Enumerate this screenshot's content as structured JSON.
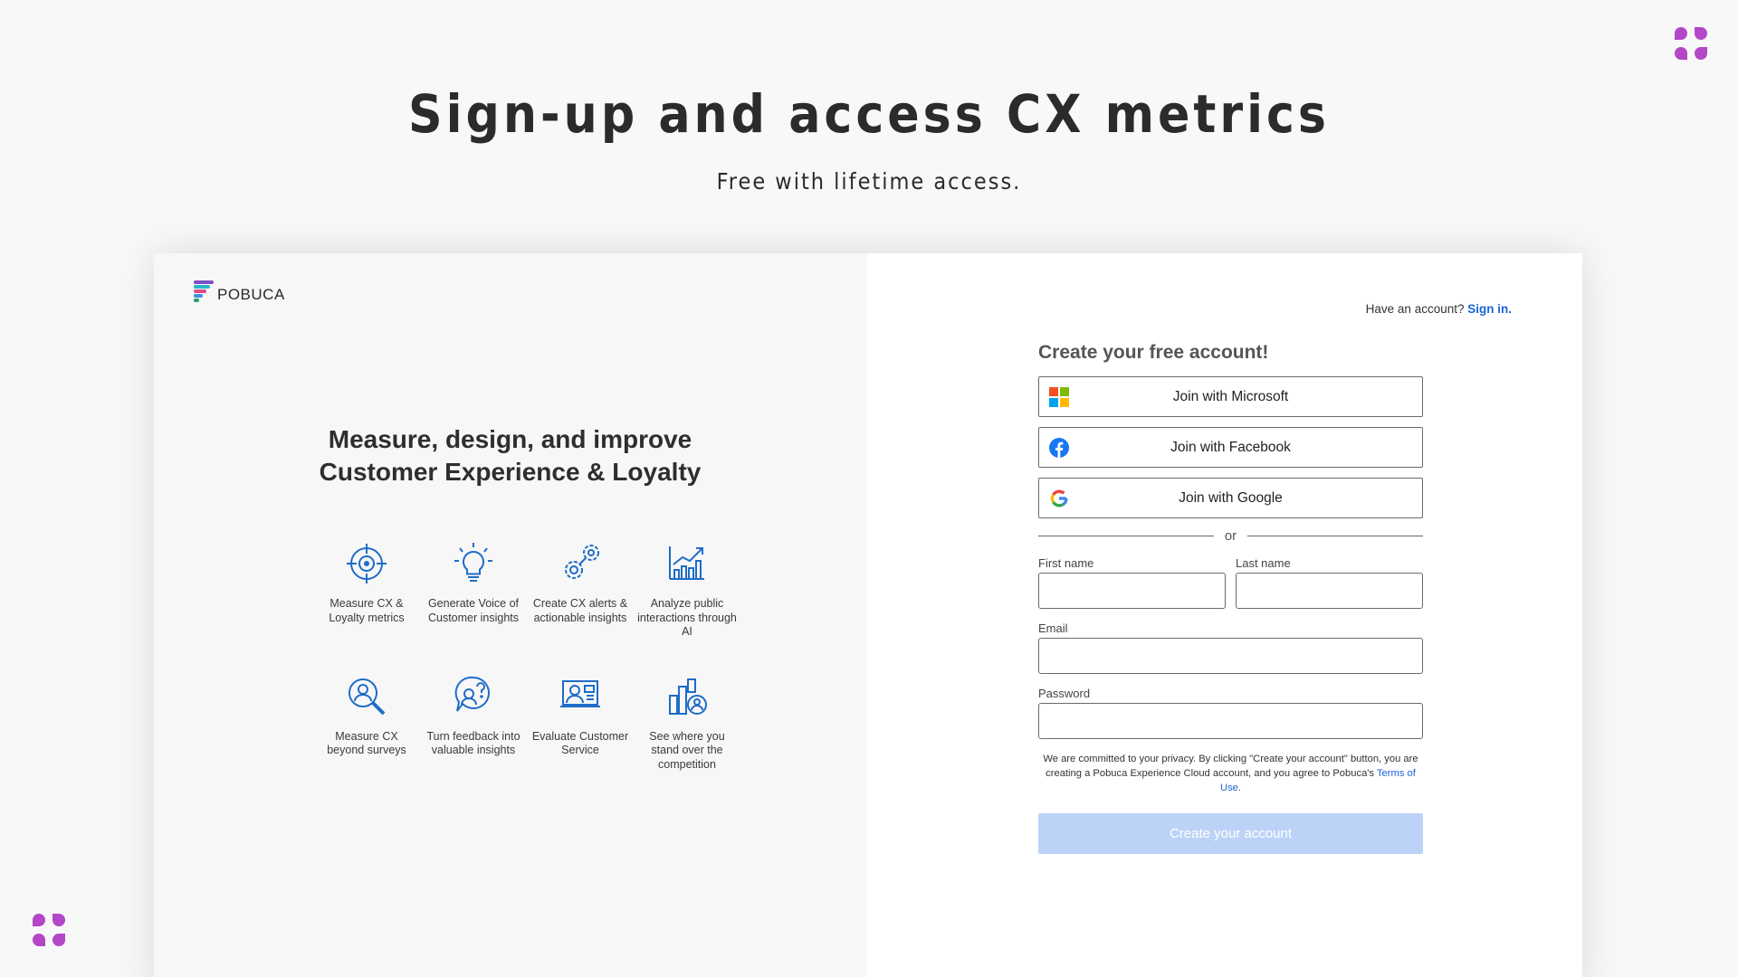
{
  "hero": {
    "title": "Sign-up and access CX metrics",
    "subtitle": "Free with lifetime access."
  },
  "brand": {
    "name": "POBUCA",
    "accent": "#b347c7",
    "link_color": "#1a64d6"
  },
  "left_panel": {
    "tagline_line1": "Measure, design, and improve",
    "tagline_line2": "Customer Experience & Loyalty",
    "features": [
      {
        "icon": "target-icon",
        "label": "Measure CX & Loyalty metrics"
      },
      {
        "icon": "lightbulb-icon",
        "label": "Generate Voice of Customer insights"
      },
      {
        "icon": "gears-icon",
        "label": "Create CX alerts & actionable insights"
      },
      {
        "icon": "chart-growth-icon",
        "label": "Analyze public interactions through AI"
      },
      {
        "icon": "search-person-icon",
        "label": "Measure CX beyond surveys"
      },
      {
        "icon": "question-person-icon",
        "label": "Turn feedback into valuable insights"
      },
      {
        "icon": "agent-screen-icon",
        "label": "Evaluate Customer Service"
      },
      {
        "icon": "competition-icon",
        "label": "See where you stand over the competition"
      }
    ]
  },
  "right_panel": {
    "have_account_text": "Have an account?",
    "sign_in_link": "Sign in.",
    "form_title": "Create your free account!",
    "sso": {
      "microsoft": "Join with Microsoft",
      "facebook": "Join with Facebook",
      "google": "Join with Google"
    },
    "divider_text": "or",
    "fields": {
      "first_name_label": "First name",
      "first_name_value": "",
      "last_name_label": "Last name",
      "last_name_value": "",
      "email_label": "Email",
      "email_value": "",
      "password_label": "Password",
      "password_value": ""
    },
    "privacy_text": "We are committed to your privacy. By clicking \"Create your account\" button, you are creating a Pobuca Experience Cloud account, and you agree to Pobuca's",
    "terms_link": "Terms of Use",
    "submit_label": "Create your account",
    "submit_color": "#bcd3f7"
  }
}
